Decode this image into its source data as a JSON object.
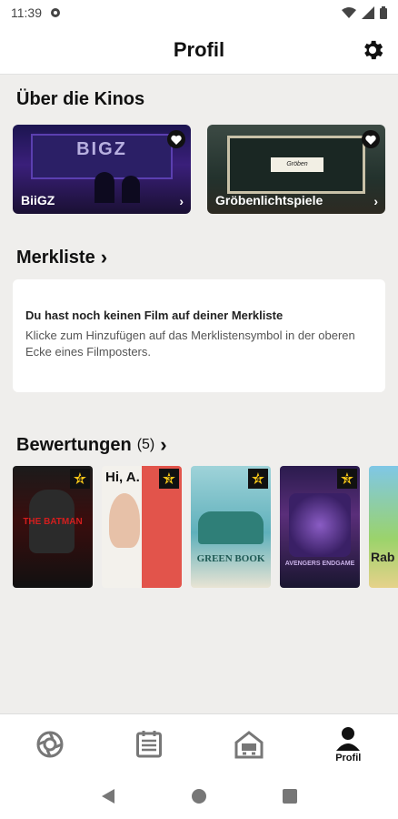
{
  "status_bar": {
    "time": "11:39"
  },
  "header": {
    "title": "Profil"
  },
  "cinemas": {
    "title": "Über die Kinos",
    "items": [
      {
        "label": "BiiGZ",
        "logo_text": "BIGZ",
        "subtitle": ""
      },
      {
        "label": "Gröbenlichtspiele",
        "logo_text": "Gröben Lichtspiele"
      }
    ]
  },
  "watchlist": {
    "title": "Merkliste",
    "empty_heading": "Du hast noch keinen Film auf deiner Merkliste",
    "empty_text": "Klicke zum Hinzufügen auf das Merklistensymbol in der oberen Ecke eines Filmposters."
  },
  "ratings": {
    "title": "Bewertungen",
    "count": "(5)",
    "posters": [
      {
        "title": "THE BATMAN",
        "rating": "4"
      },
      {
        "title": "Hi, A.",
        "rating": "3"
      },
      {
        "title": "GREEN BOOK",
        "rating": "4"
      },
      {
        "title": "AVENGERS ENDGAME",
        "rating": "3"
      },
      {
        "title": "Rab",
        "rating": ""
      }
    ]
  },
  "bottom_nav": {
    "items": [
      {
        "icon": "cinema-reel-icon",
        "label": ""
      },
      {
        "icon": "calendar-list-icon",
        "label": ""
      },
      {
        "icon": "theater-house-icon",
        "label": ""
      },
      {
        "icon": "profile-icon",
        "label": "Profil"
      }
    ]
  },
  "colors": {
    "accent": "#111111",
    "star": "#f5c518",
    "background": "#efeeec"
  }
}
